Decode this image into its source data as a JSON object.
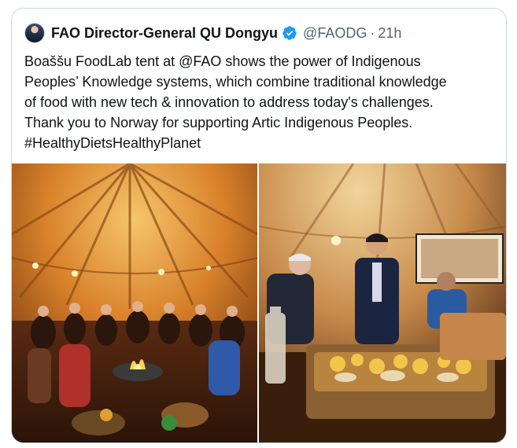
{
  "tweet": {
    "author_name": "FAO Director-General QU Dongyu",
    "handle": "@FAODG",
    "separator": "·",
    "time": "21h",
    "verified": true,
    "text_lines": [
      "Boaššu FoodLab tent at @FAO shows the power of Indigenous",
      "Peoples’ Knowledge systems, which combine traditional knowledge",
      "of food with new tech & innovation to address today's challenges.",
      "Thank you to Norway for supporting Artic Indigenous Peoples.",
      "#HealthyDietsHealthyPlanet"
    ]
  },
  "icons": {
    "avatar": "avatar-photo",
    "verified": "verified-badge-icon"
  },
  "colors": {
    "verified_blue": "#1d9bf0",
    "secondary_text": "#536471",
    "border": "#cfd9de",
    "tent_orange": "#e0882e"
  }
}
